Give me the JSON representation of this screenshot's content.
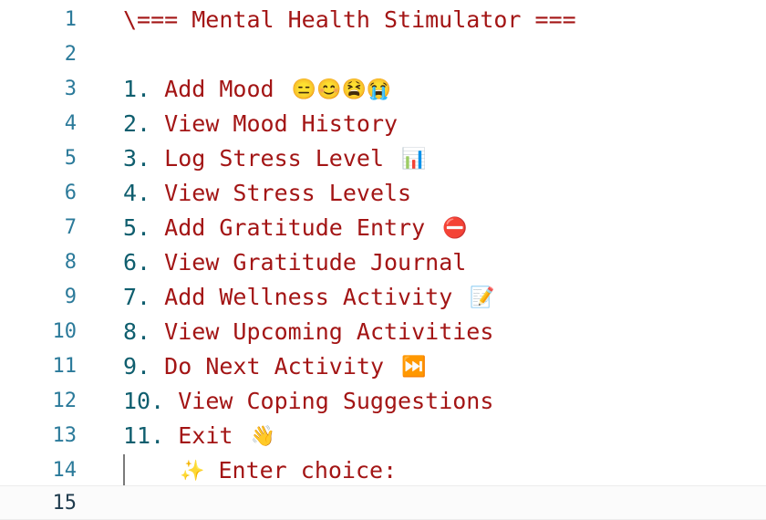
{
  "editor": {
    "lines": [
      {
        "no": "1",
        "text": "\\=== Mental Health Stimulator ==="
      },
      {
        "no": "2",
        "text": ""
      },
      {
        "no": "3",
        "num": "1.",
        "label": "Add Mood",
        "emoji": "😑😊😫😭"
      },
      {
        "no": "4",
        "num": "2.",
        "label": "View Mood History",
        "emoji": ""
      },
      {
        "no": "5",
        "num": "3.",
        "label": "Log Stress Level",
        "emoji": "📊"
      },
      {
        "no": "6",
        "num": "4.",
        "label": "View Stress Levels",
        "emoji": ""
      },
      {
        "no": "7",
        "num": "5.",
        "label": "Add Gratitude Entry",
        "emoji": "⛔"
      },
      {
        "no": "8",
        "num": "6.",
        "label": "View Gratitude Journal",
        "emoji": ""
      },
      {
        "no": "9",
        "num": "7.",
        "label": "Add Wellness Activity",
        "emoji": "📝"
      },
      {
        "no": "10",
        "num": "8.",
        "label": "View Upcoming Activities",
        "emoji": ""
      },
      {
        "no": "11",
        "num": "9.",
        "label": "Do Next Activity",
        "emoji": "⏭️"
      },
      {
        "no": "12",
        "num": "10.",
        "label": "View Coping Suggestions",
        "emoji": ""
      },
      {
        "no": "13",
        "num": "11.",
        "label": "Exit",
        "emoji": "👋"
      },
      {
        "no": "14",
        "emoji": "✨",
        "label": "Enter choice:"
      },
      {
        "no": "15",
        "text": ""
      }
    ]
  }
}
